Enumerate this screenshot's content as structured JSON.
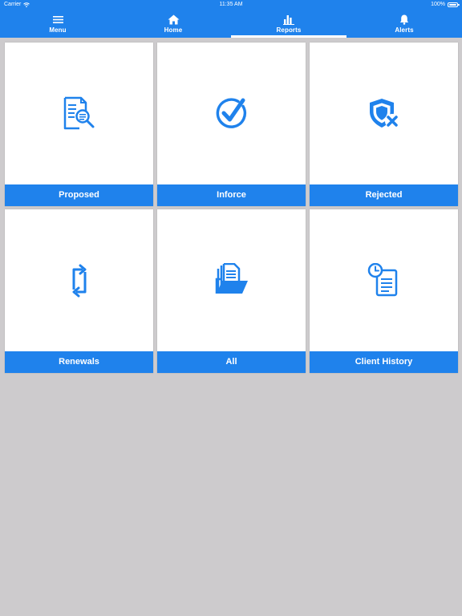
{
  "status_bar": {
    "carrier": "Carrier",
    "time": "11:35 AM",
    "battery": "100%"
  },
  "nav": {
    "tabs": [
      {
        "label": "Menu",
        "icon": "hamburger-icon"
      },
      {
        "label": "Home",
        "icon": "home-icon"
      },
      {
        "label": "Reports",
        "icon": "bar-chart-icon",
        "active": true
      },
      {
        "label": "Alerts",
        "icon": "bell-icon"
      }
    ]
  },
  "tiles": [
    {
      "label": "Proposed",
      "icon": "document-search-icon"
    },
    {
      "label": "Inforce",
      "icon": "check-circle-icon"
    },
    {
      "label": "Rejected",
      "icon": "shield-x-icon"
    },
    {
      "label": "Renewals",
      "icon": "renew-arrows-icon"
    },
    {
      "label": "All",
      "icon": "open-folder-icon"
    },
    {
      "label": "Client History",
      "icon": "history-clipboard-icon"
    }
  ],
  "colors": {
    "accent": "#1f82ec",
    "background": "#cdcbcd",
    "tile": "#ffffff"
  }
}
